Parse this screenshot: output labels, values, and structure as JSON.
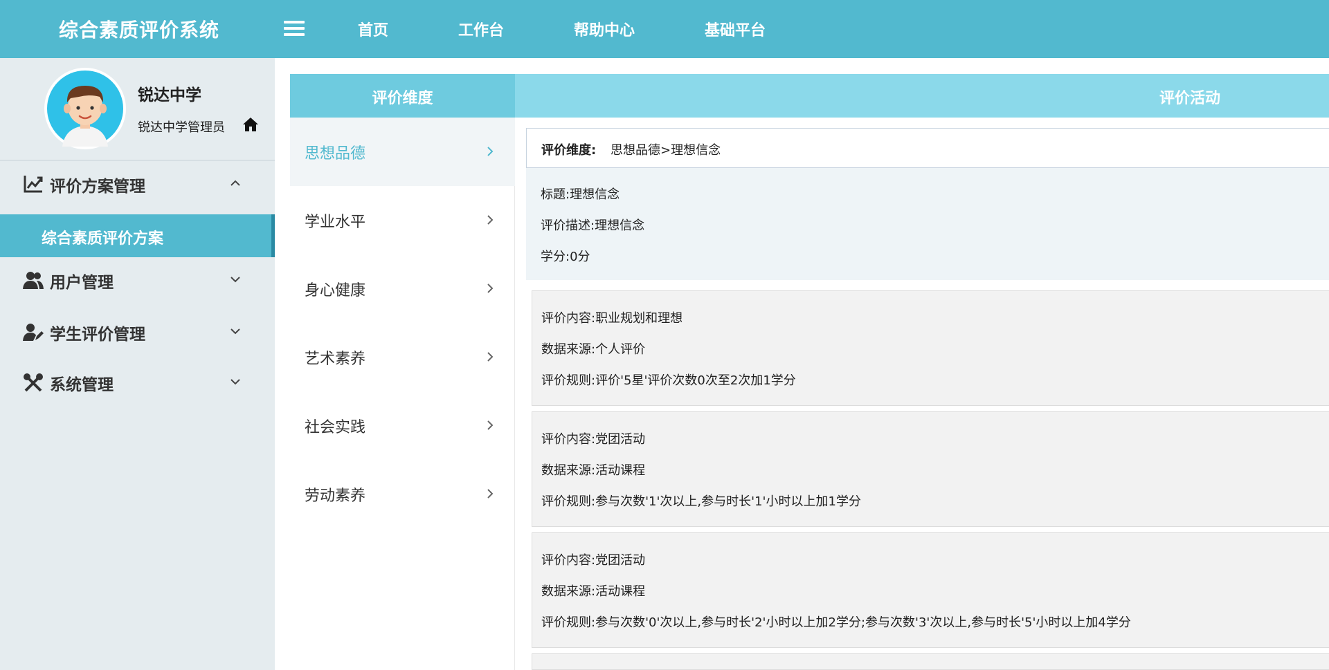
{
  "app": {
    "title": "综合素质评价系统"
  },
  "nav": {
    "items": [
      {
        "label": "首页"
      },
      {
        "label": "工作台"
      },
      {
        "label": "帮助中心"
      },
      {
        "label": "基础平台"
      }
    ]
  },
  "profile": {
    "school": "锐达中学",
    "admin": "锐达中学管理员"
  },
  "sidebar": {
    "menus": [
      {
        "label": "评价方案管理",
        "icon": "chart-line-icon",
        "expanded": true
      },
      {
        "label": "用户管理",
        "icon": "users-icon",
        "expanded": false
      },
      {
        "label": "学生评价管理",
        "icon": "user-edit-icon",
        "expanded": false
      },
      {
        "label": "系统管理",
        "icon": "tools-icon",
        "expanded": false
      }
    ],
    "active_sub": "综合素质评价方案"
  },
  "headers": {
    "dimension": "评价维度",
    "activity": "评价活动"
  },
  "dimensions": [
    {
      "label": "思想品德",
      "active": true
    },
    {
      "label": "学业水平",
      "active": false
    },
    {
      "label": "身心健康",
      "active": false
    },
    {
      "label": "艺术素养",
      "active": false
    },
    {
      "label": "社会实践",
      "active": false
    },
    {
      "label": "劳动素养",
      "active": false
    }
  ],
  "activity": {
    "path_label": "评价维度:",
    "path_value": "思想品德>理想信念",
    "summary": {
      "title_label": "标题:",
      "title_value": "理想信念",
      "desc_label": "评价描述:",
      "desc_value": "理想信念",
      "credit_label": "学分:",
      "credit_value": "0分"
    },
    "rules": [
      {
        "content_label": "评价内容:",
        "content": "职业规划和理想",
        "source_label": "数据来源:",
        "source": "个人评价",
        "rule_label": "评价规则:",
        "rule": "评价'5星'评价次数0次至2次加1学分"
      },
      {
        "content_label": "评价内容:",
        "content": "党团活动",
        "source_label": "数据来源:",
        "source": "活动课程",
        "rule_label": "评价规则:",
        "rule": "参与次数'1'次以上,参与时长'1'小时以上加1学分"
      },
      {
        "content_label": "评价内容:",
        "content": "党团活动",
        "source_label": "数据来源:",
        "source": "活动课程",
        "rule_label": "评价规则:",
        "rule": "参与次数'0'次以上,参与时长'2'小时以上加2学分;参与次数'3'次以上,参与时长'5'小时以上加4学分"
      }
    ]
  },
  "colors": {
    "primary": "#52b9cf",
    "header_dim": "#6ecbdf",
    "header_act": "#8bd9ea",
    "sidebar_bg": "#e5ecef"
  }
}
